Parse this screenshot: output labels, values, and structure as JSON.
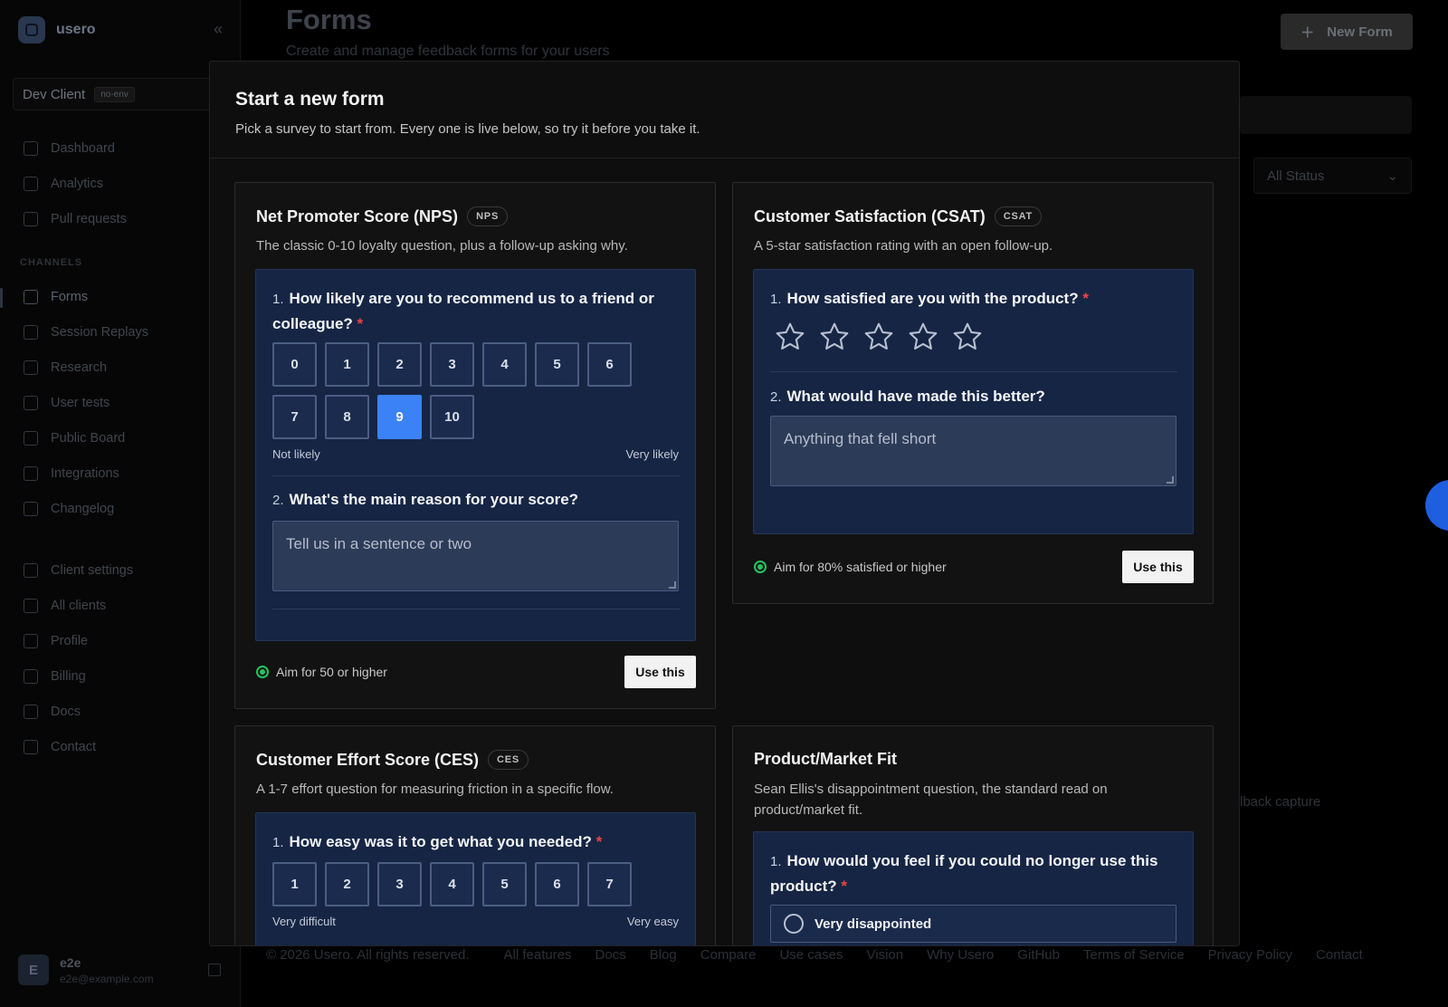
{
  "app": {
    "brand": "usero",
    "client_name": "Dev Client",
    "env_badge": "no-env"
  },
  "sidebar": {
    "primary": [
      {
        "label": "Dashboard"
      },
      {
        "label": "Analytics"
      },
      {
        "label": "Pull requests"
      }
    ],
    "channels_label": "CHANNELS",
    "channels": [
      {
        "label": "Forms"
      },
      {
        "label": "Session Replays"
      },
      {
        "label": "Research"
      },
      {
        "label": "User tests"
      },
      {
        "label": "Public Board"
      },
      {
        "label": "Integrations"
      },
      {
        "label": "Changelog"
      }
    ],
    "settings": [
      {
        "label": "Client settings"
      },
      {
        "label": "All clients"
      },
      {
        "label": "Profile"
      },
      {
        "label": "Billing"
      },
      {
        "label": "Docs"
      },
      {
        "label": "Contact"
      }
    ],
    "user": {
      "initial": "E",
      "name": "e2e",
      "email": "e2e@example.com"
    }
  },
  "header": {
    "title": "Forms",
    "subtitle": "Create and manage feedback forms for your users",
    "new_form_label": "New Form",
    "status_filter": "All Status",
    "partial_text": "lback capture"
  },
  "footer": {
    "copyright": "© 2026 Usero. All rights reserved.",
    "links": [
      "All features",
      "Docs",
      "Blog",
      "Compare",
      "Use cases",
      "Vision",
      "Why Usero",
      "GitHub",
      "Terms of Service",
      "Privacy Policy",
      "Contact"
    ]
  },
  "modal": {
    "title": "Start a new form",
    "subtitle": "Pick a survey to start from. Every one is live below, so try it before you take it.",
    "use_label": "Use this",
    "templates": {
      "nps": {
        "name": "Net Promoter Score (NPS)",
        "abbr": "NPS",
        "description": "The classic 0-10 loyalty question, plus a follow-up asking why.",
        "q1_num": "1.",
        "q1_line1": "How likely are you to recommend us to a friend or",
        "q1_line2": "colleague?",
        "scale": [
          "0",
          "1",
          "2",
          "3",
          "4",
          "5",
          "6",
          "7",
          "8",
          "9",
          "10"
        ],
        "selected": "9",
        "low_hint": "Not likely",
        "high_hint": "Very likely",
        "q2_num": "2.",
        "q2": "What's the main reason for your score?",
        "q2_placeholder": "Tell us in a sentence or two",
        "goal": "Aim for 50 or higher"
      },
      "csat": {
        "name": "Customer Satisfaction (CSAT)",
        "abbr": "CSAT",
        "description": "A 5-star satisfaction rating with an open follow-up.",
        "q1_num": "1.",
        "q1": "How satisfied are you with the product?",
        "stars": 5,
        "q2_num": "2.",
        "q2": "What would have made this better?",
        "q2_placeholder": "Anything that fell short",
        "goal": "Aim for 80% satisfied or higher"
      },
      "ces": {
        "name": "Customer Effort Score (CES)",
        "abbr": "CES",
        "description": "A 1-7 effort question for measuring friction in a specific flow.",
        "q1_num": "1.",
        "q1": "How easy was it to get what you needed?",
        "scale": [
          "1",
          "2",
          "3",
          "4",
          "5",
          "6",
          "7"
        ],
        "low_hint": "Very difficult",
        "high_hint": "Very easy"
      },
      "pmf": {
        "name": "Product/Market Fit",
        "description_line1": "Sean Ellis's disappointment question, the standard read on",
        "description_line2": "product/market fit.",
        "q1_num": "1.",
        "q1_line1": "How would you feel if you could no longer use this",
        "q1_line2": "product?",
        "option1": "Very disappointed"
      }
    }
  }
}
